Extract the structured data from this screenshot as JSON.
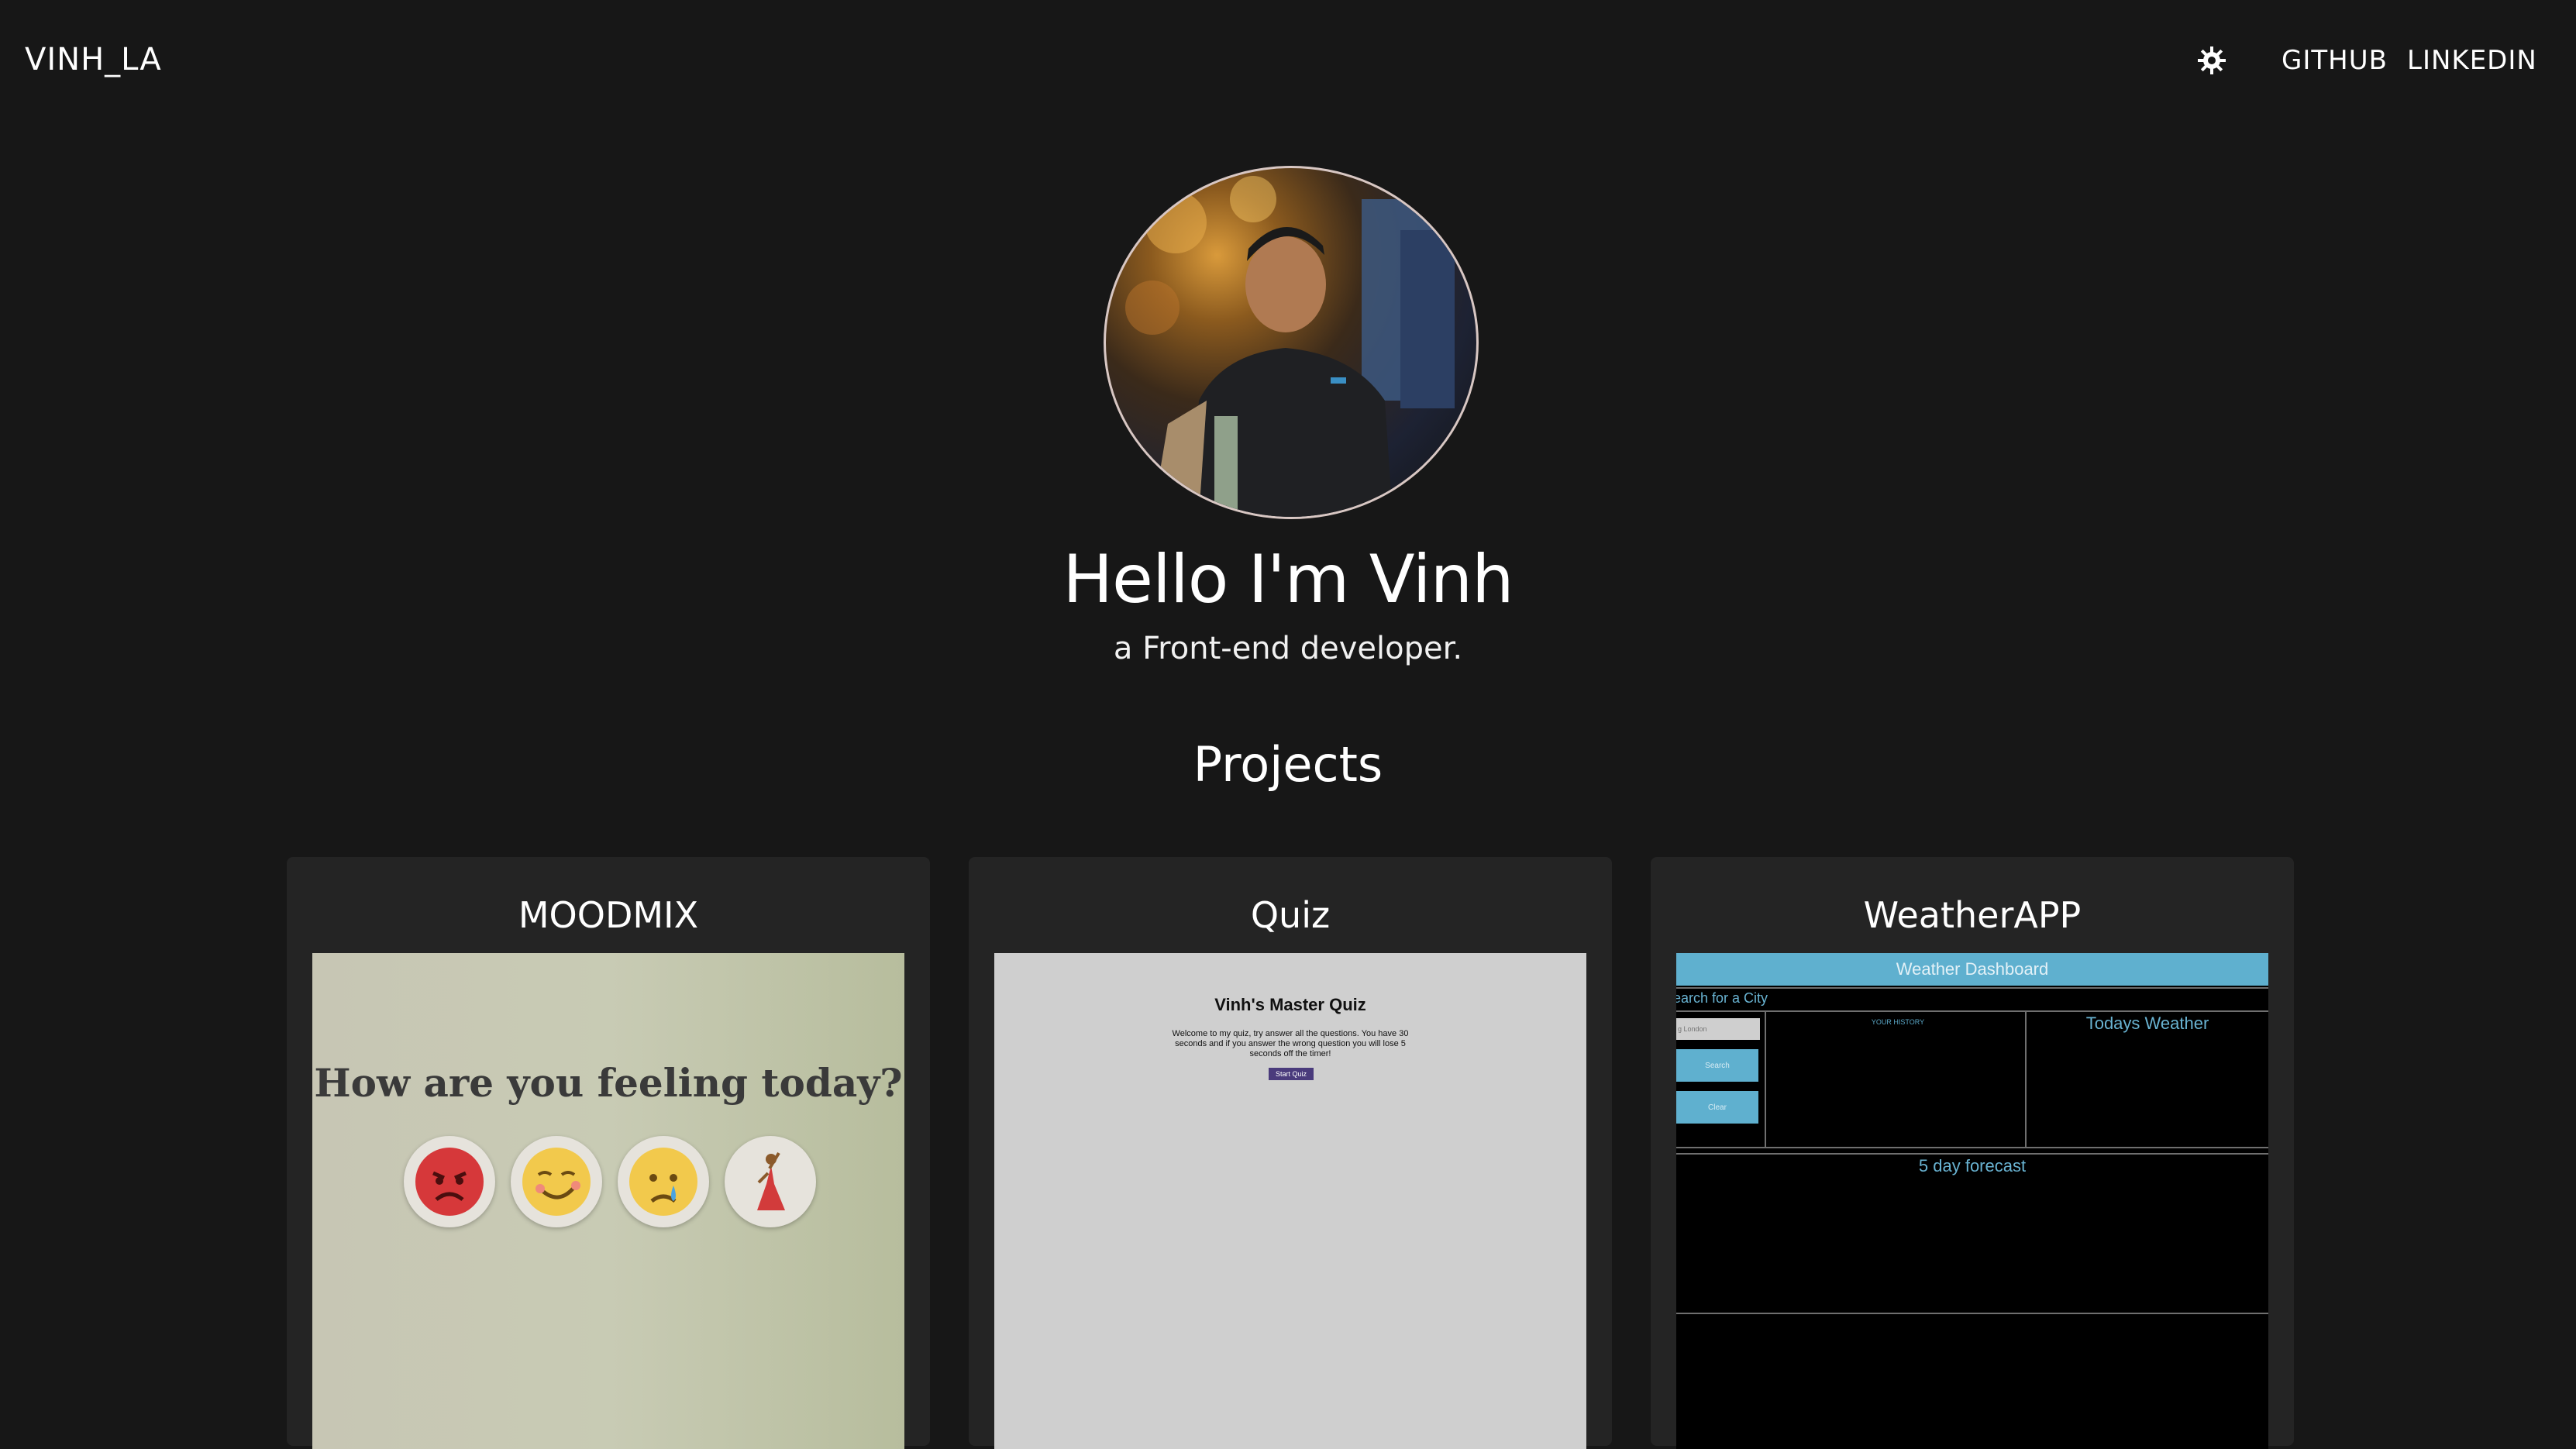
{
  "nav": {
    "brand": "VINH_LA",
    "theme_icon": "gear-sun-icon",
    "links": [
      "GITHUB",
      "LINKEDIN"
    ]
  },
  "hero": {
    "title": "Hello I'm Vinh",
    "subtitle": "a Front-end developer."
  },
  "projects": {
    "title": "Projects",
    "cards": [
      {
        "title": "MOODMIX",
        "preview": {
          "question": "How are you feeling today?",
          "emoji_icons": [
            "angry-face-icon",
            "smiling-face-icon",
            "crying-face-icon",
            "dancer-icon"
          ]
        }
      },
      {
        "title": "Quiz",
        "preview": {
          "heading": "Vinh's Master Quiz",
          "description": "Welcome to my quiz, try answer all the questions. You have 30 seconds and if you answer the wrong question you will lose 5 seconds off the timer!",
          "button": "Start Quiz"
        }
      },
      {
        "title": "WeatherAPP",
        "preview": {
          "header": "Weather Dashboard",
          "search_label": "earch for a City",
          "input_placeholder": "g London",
          "search_button": "Search",
          "clear_button": "Clear",
          "history_label": "YOUR HISTORY",
          "today_label": "Todays Weather",
          "forecast_label": "5 day forecast"
        }
      }
    ]
  },
  "colors": {
    "background": "#171717",
    "card": "#242424",
    "weather_accent": "#5fb0cf",
    "quiz_button": "#4a3b7c"
  }
}
